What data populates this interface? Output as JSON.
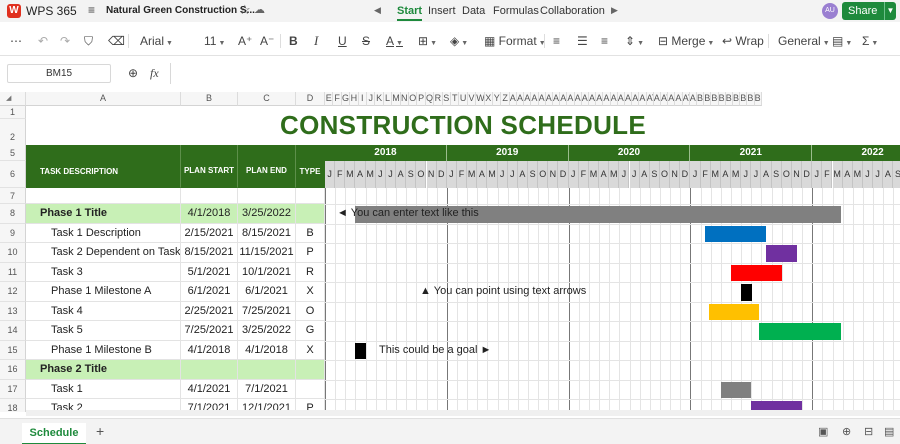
{
  "titlebar": {
    "app_name": "WPS 365",
    "logo": "W",
    "doc_title": "Natural Green Construction S...",
    "nav": [
      "Start",
      "Insert",
      "Data",
      "Formulas",
      "Collaboration"
    ],
    "avatar": "AU",
    "share": "Share"
  },
  "toolbar": {
    "font": "Arial",
    "size": "11",
    "grow": "A⁺",
    "shrink": "A⁻",
    "bold": "B",
    "italic": "I",
    "underline": "U",
    "strike": "S",
    "fontcolor": "A",
    "format": "Format",
    "merge": "Merge",
    "wrap": "Wrap",
    "numfmt": "General",
    "sum": "Σ"
  },
  "formula_bar": {
    "cell_ref": "BM15",
    "fx": "fx",
    "value": ""
  },
  "columns": {
    "main": [
      "A",
      "B",
      "C",
      "D"
    ],
    "timeline": [
      "E",
      "F",
      "G",
      "H",
      "I",
      "J",
      "K",
      "L",
      "M",
      "N",
      "O",
      "P",
      "Q",
      "R",
      "S",
      "T",
      "U",
      "V",
      "W",
      "X",
      "Y",
      "Z",
      "AA",
      "AB",
      "AC",
      "AD",
      "AE",
      "AF",
      "AG",
      "AH",
      "AI",
      "AJ",
      "AK",
      "AL",
      "AM",
      "AN",
      "AO",
      "AP",
      "AQ",
      "AR",
      "AS",
      "AT",
      "AU",
      "AV",
      "AW",
      "AX",
      "AY",
      "AZ",
      "BA",
      "BB",
      "BC",
      "BD",
      "BE",
      "BF",
      "BG",
      "BH",
      "BI"
    ]
  },
  "rows": [
    "1",
    "2",
    "5",
    "6",
    "7",
    "8",
    "9",
    "10",
    "11",
    "12",
    "13",
    "14",
    "15",
    "16",
    "17",
    "18"
  ],
  "sheet_title": "CONSTRUCTION SCHEDULE",
  "table_header": {
    "task": "TASK DESCRIPTION",
    "start": "PLAN START",
    "end": "PLAN END",
    "type": "TYPE"
  },
  "years": [
    "2018",
    "2019",
    "2020",
    "2021",
    "2022"
  ],
  "month_letters": [
    "J",
    "F",
    "M",
    "A",
    "M",
    "J",
    "J",
    "A",
    "S",
    "O",
    "N",
    "D"
  ],
  "tasks": [
    {
      "row": "8",
      "name": "Phase 1 Title",
      "start": "4/1/2018",
      "end": "3/25/2022",
      "type": "",
      "phase": true
    },
    {
      "row": "9",
      "name": "Task 1 Description",
      "start": "2/15/2021",
      "end": "8/15/2021",
      "type": "B",
      "phase": false
    },
    {
      "row": "10",
      "name": "Task 2 Dependent on Task 1",
      "start": "8/15/2021",
      "end": "11/15/2021",
      "type": "P",
      "phase": false
    },
    {
      "row": "11",
      "name": "Task 3",
      "start": "5/1/2021",
      "end": "10/1/2021",
      "type": "R",
      "phase": false
    },
    {
      "row": "12",
      "name": "Phase 1 Milestone A",
      "start": "6/1/2021",
      "end": "6/1/2021",
      "type": "X",
      "phase": false
    },
    {
      "row": "13",
      "name": "Task 4",
      "start": "2/25/2021",
      "end": "7/25/2021",
      "type": "O",
      "phase": false
    },
    {
      "row": "14",
      "name": "Task 5",
      "start": "7/25/2021",
      "end": "3/25/2022",
      "type": "G",
      "phase": false
    },
    {
      "row": "15",
      "name": "Phase 1 Milestone B",
      "start": "4/1/2018",
      "end": "4/1/2018",
      "type": "X",
      "phase": false
    },
    {
      "row": "16",
      "name": "Phase 2 Title",
      "start": "",
      "end": "",
      "type": "",
      "phase": true
    },
    {
      "row": "17",
      "name": "Task 1",
      "start": "4/1/2021",
      "end": "7/1/2021",
      "type": "",
      "phase": false
    },
    {
      "row": "18",
      "name": "Task 2",
      "start": "7/1/2021",
      "end": "12/1/2021",
      "type": "P",
      "phase": false
    }
  ],
  "annotations": [
    {
      "row": "8",
      "text": "◄ You can enter text like this"
    },
    {
      "row": "12",
      "text": "▲ You can point using text arrows"
    },
    {
      "row": "15",
      "text": "This could be a goal ►"
    }
  ],
  "bar_colors": {
    "phase": "#808080",
    "B": "#0070c0",
    "P": "#7030a0",
    "R": "#ff0000",
    "X": "#000000",
    "O": "#ffc000",
    "G": "#00b050",
    "default": "#808080"
  },
  "sheets": [
    "Schedule"
  ]
}
